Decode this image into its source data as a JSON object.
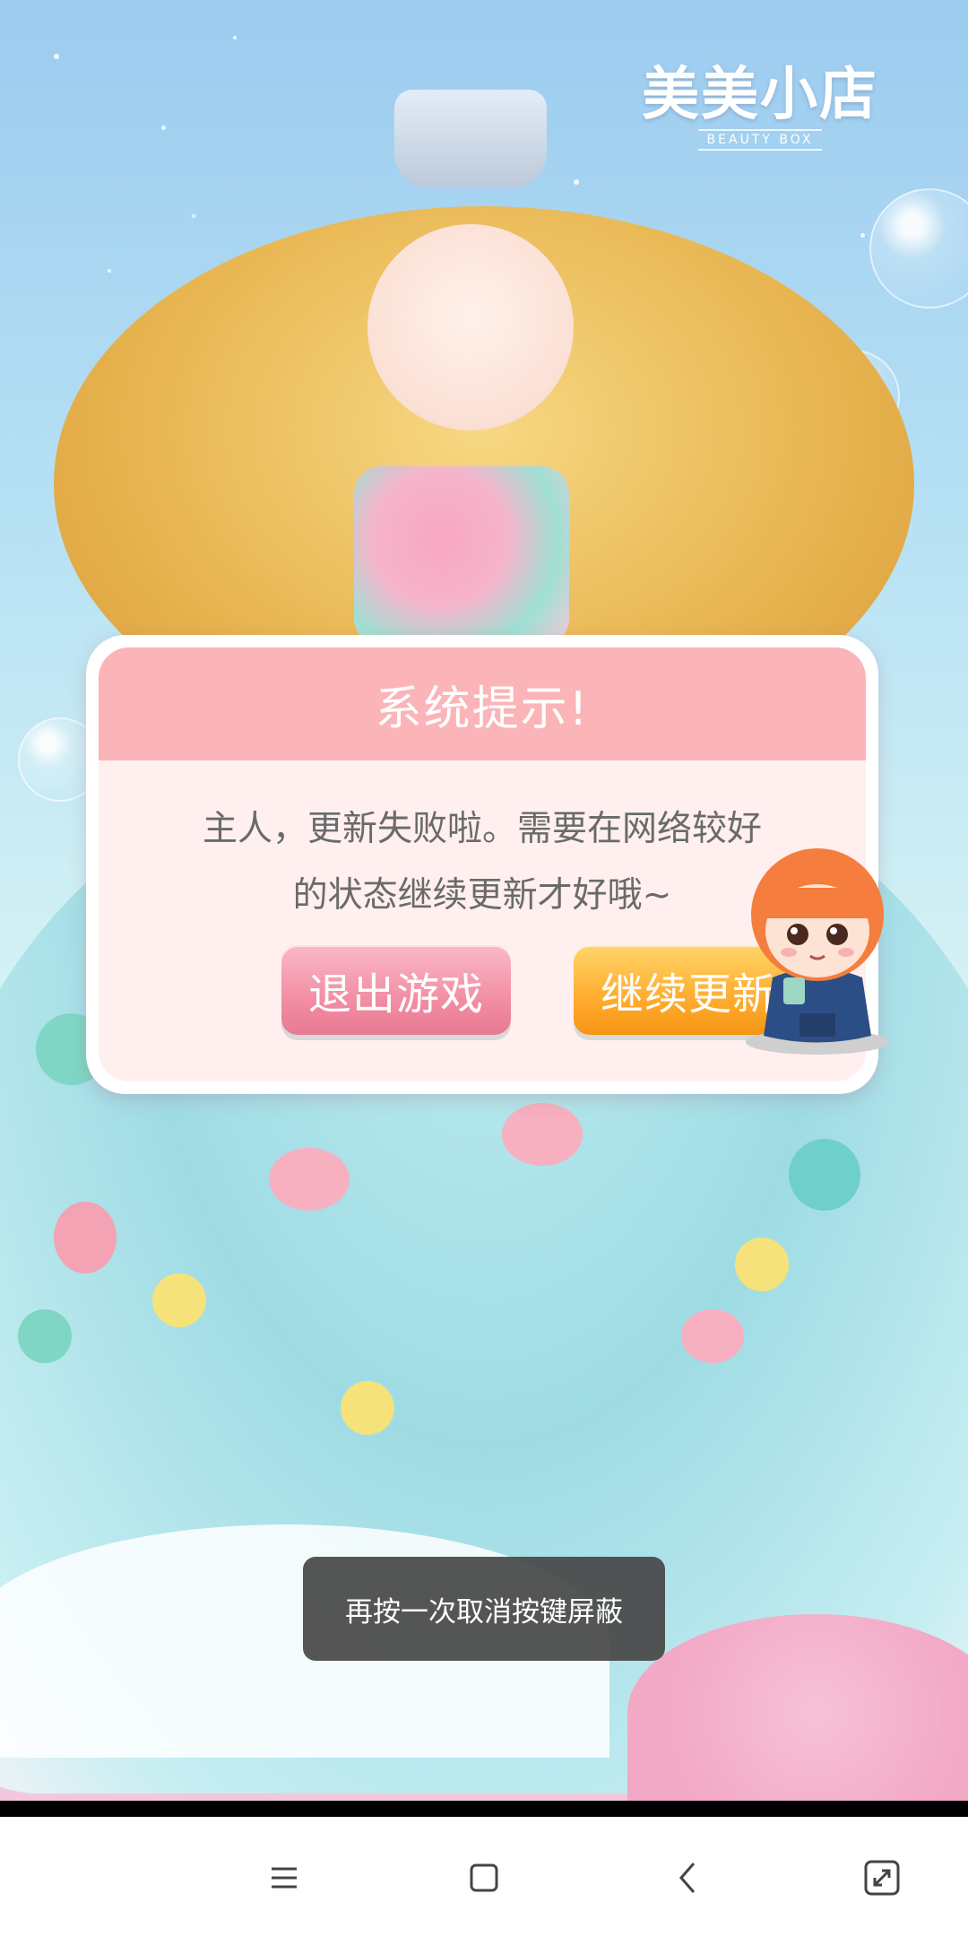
{
  "logo": {
    "main": "美美小店",
    "sub": "BEAUTY BOX"
  },
  "dialog": {
    "title": "系统提示!",
    "message_line1": "主人，更新失败啦。需要在网络较好",
    "message_line2": "的状态继续更新才好哦~",
    "exit_button": "退出游戏",
    "continue_button": "继续更新"
  },
  "toast": {
    "text": "再按一次取消按键屏蔽"
  },
  "nav_bar": {
    "icons": [
      "menu-icon",
      "home-icon",
      "back-icon",
      "fullscreen-icon"
    ]
  },
  "colors": {
    "dialog_header": "#fbb4b8",
    "dialog_body": "#fff0ef",
    "exit_button": "#f28ea4",
    "continue_button": "#ffac2e"
  }
}
